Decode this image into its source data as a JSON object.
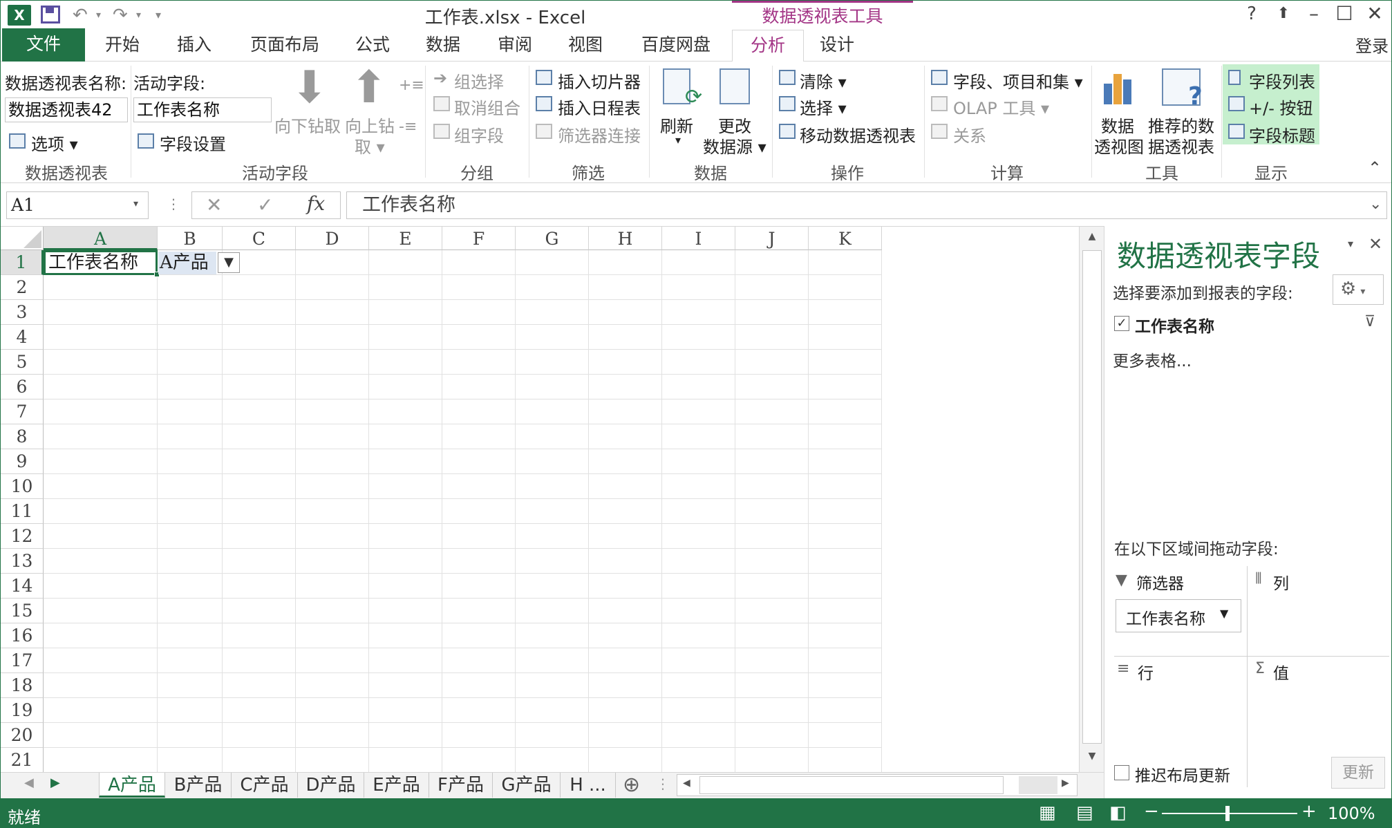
{
  "window": {
    "title": "工作表.xlsx - Excel",
    "context_tools": "数据透视表工具",
    "help": "?",
    "login": "登录"
  },
  "tabs": {
    "file": "文件",
    "items": [
      "开始",
      "插入",
      "页面布局",
      "公式",
      "数据",
      "审阅",
      "视图",
      "百度网盘",
      "分析",
      "设计"
    ]
  },
  "ribbon": {
    "pivot_name_label": "数据透视表名称:",
    "pivot_name_value": "数据透视表42",
    "options": "选项 ▾",
    "active_field_label": "活动字段:",
    "active_field_value": "工作表名称",
    "field_settings": "字段设置",
    "drill_down": "向下钻取",
    "drill_up": "向上钻",
    "drill_up2": "取 ▾",
    "group_selection": "组选择",
    "ungroup": "取消组合",
    "group_field": "组字段",
    "insert_slicer": "插入切片器",
    "insert_timeline": "插入日程表",
    "filter_connections": "筛选器连接",
    "refresh": "刷新",
    "refresh_arrow": "▾",
    "change_source": "更改",
    "change_source2": "数据源 ▾",
    "clear": "清除 ▾",
    "select": "选择 ▾",
    "move_pivot": "移动数据透视表",
    "fields_items_sets": "字段、项目和集 ▾",
    "olap_tools": "OLAP 工具 ▾",
    "relationships": "关系",
    "pivot_chart": "数据",
    "pivot_chart2": "透视图",
    "recommended": "推荐的数",
    "recommended2": "据透视表",
    "field_list": "字段列表",
    "buttons": "+/- 按钮",
    "field_headers": "字段标题",
    "groups": [
      "数据透视表",
      "活动字段",
      "分组",
      "筛选",
      "数据",
      "操作",
      "计算",
      "工具",
      "显示"
    ]
  },
  "formula_bar": {
    "name_box": "A1",
    "formula": "工作表名称",
    "fx": "fx"
  },
  "grid": {
    "columns": [
      "A",
      "B",
      "C",
      "D",
      "E",
      "F",
      "G",
      "H",
      "I",
      "J",
      "K"
    ],
    "rows": [
      "1",
      "2",
      "3",
      "4",
      "5",
      "6",
      "7",
      "8",
      "9",
      "10",
      "11",
      "12",
      "13",
      "14",
      "15",
      "16",
      "17",
      "18",
      "19",
      "20",
      "21"
    ],
    "a1": "工作表名称",
    "b1": "A产品"
  },
  "sheet_tabs": [
    "A产品",
    "B产品",
    "C产品",
    "D产品",
    "E产品",
    "F产品",
    "G产品",
    "H ..."
  ],
  "pane": {
    "title": "数据透视表字段",
    "choose_label": "选择要添加到报表的字段:",
    "field": "工作表名称",
    "more_tables": "更多表格...",
    "drag_label": "在以下区域间拖动字段:",
    "filters": "筛选器",
    "columns": "列",
    "rows": "行",
    "values": "值",
    "filter_item": "工作表名称",
    "defer": "推迟布局更新",
    "update": "更新"
  },
  "status": {
    "ready": "就绪",
    "zoom": "100%"
  }
}
